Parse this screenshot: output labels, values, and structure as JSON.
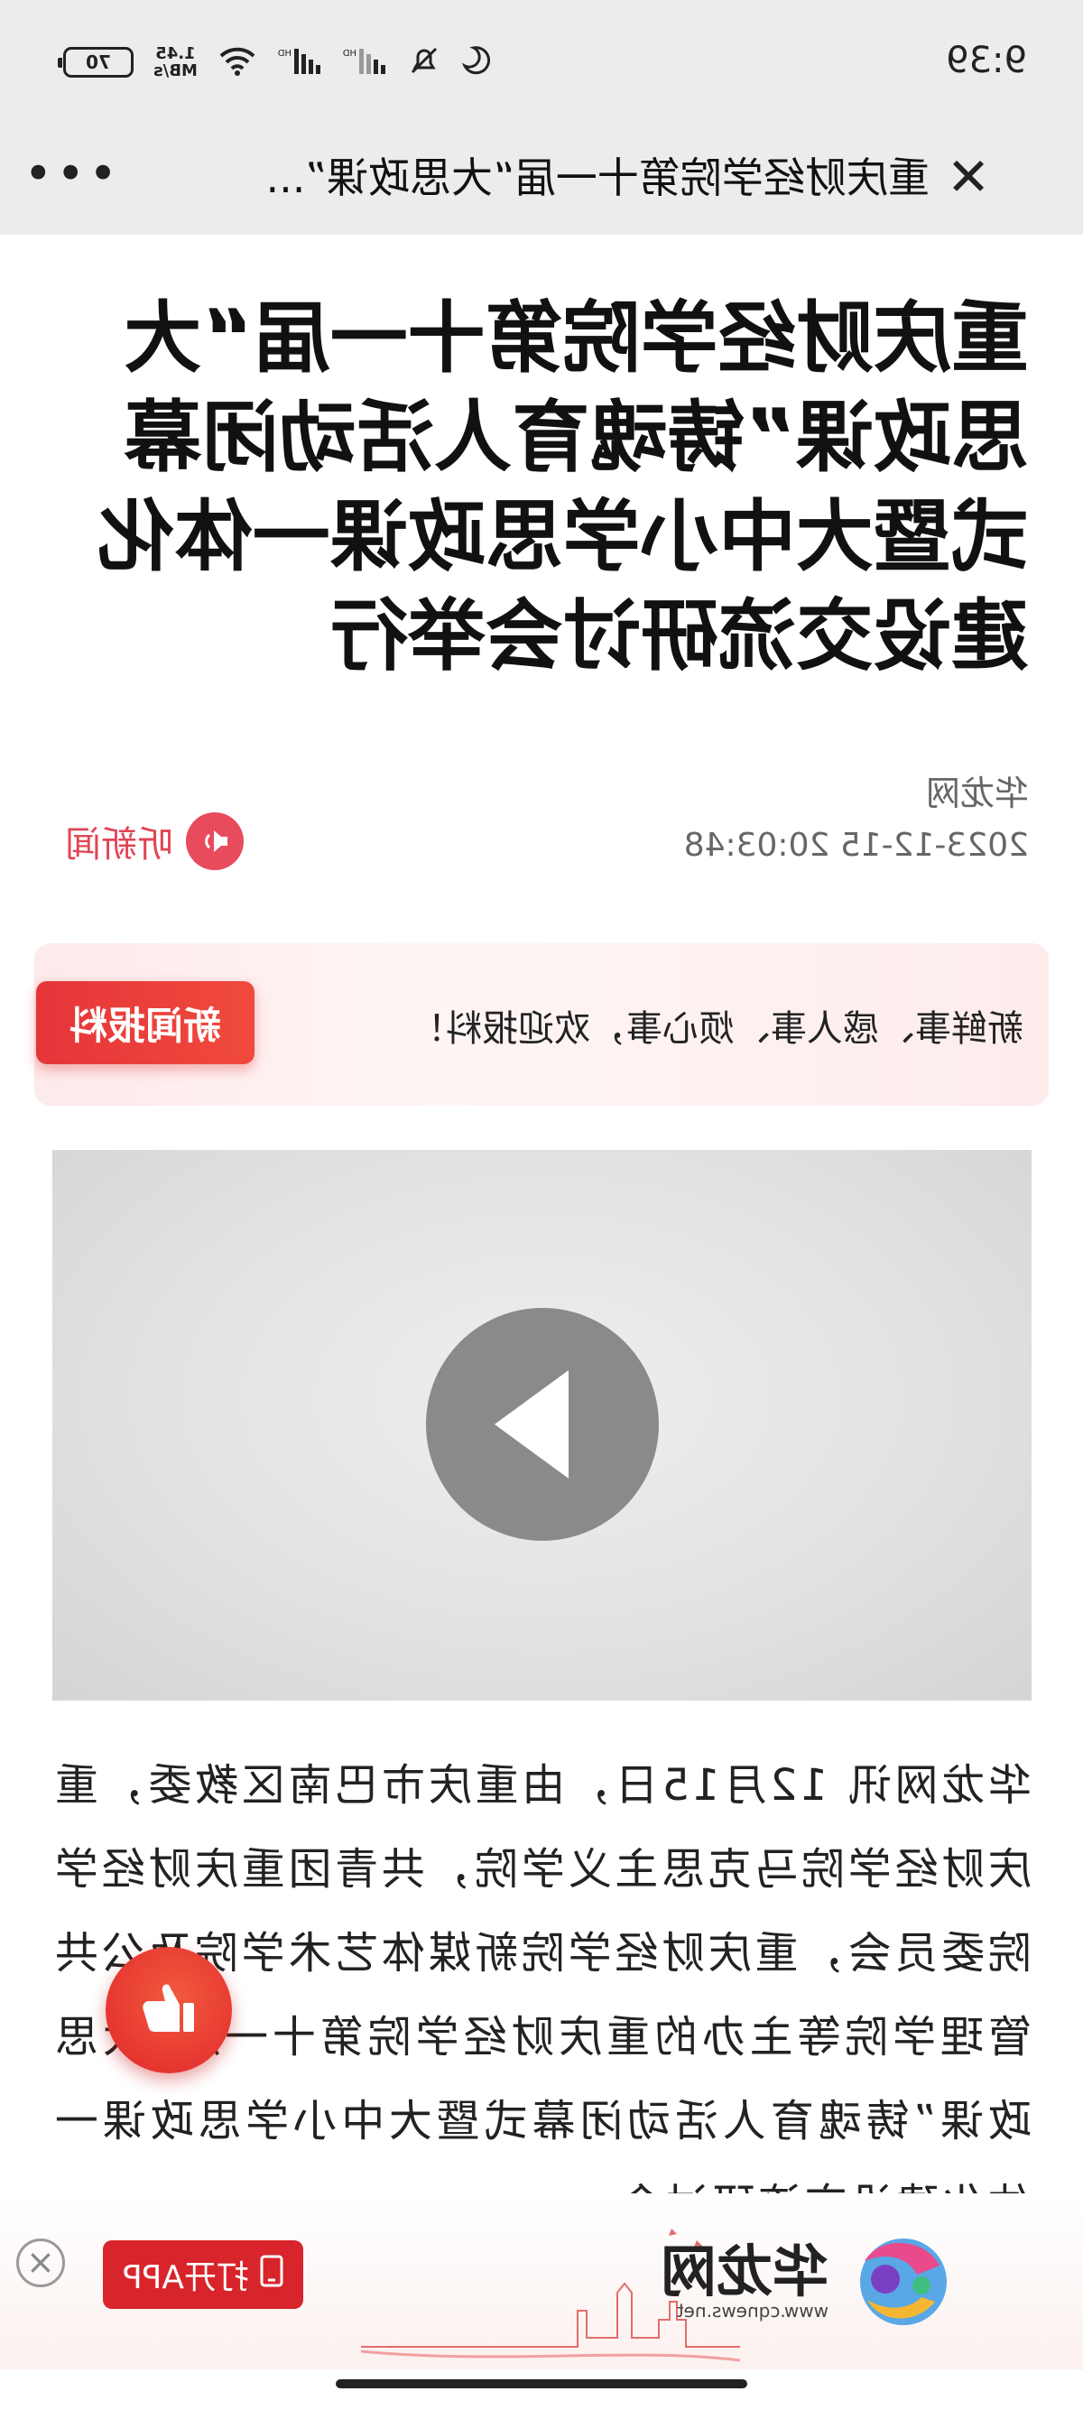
{
  "status_bar": {
    "time": "9:39",
    "network_speed_value": "1.45",
    "network_speed_unit": "MB/s",
    "battery_level": "70",
    "icons": [
      "moon-icon",
      "bell-muted-icon",
      "signal-hd-icon",
      "signal-hd-icon",
      "wifi-icon",
      "battery-icon"
    ]
  },
  "nav": {
    "title": "重庆财经学院第十一届“大思政课”...",
    "close_icon": "close-icon",
    "more_icon": "more-icon"
  },
  "article": {
    "headline": "重庆财经学院第十一届“大思政课”铸魂育人活动闭幕式暨大中小学思政课一体化建设交流研讨会举行",
    "source": "华龙网",
    "datetime": "2023-12-15 20:03:48",
    "listen_label": "听新闻",
    "body": "华龙网讯 12月15日，由重庆市巴南区教委，重庆财经学院马克思主义学院，共青团重庆财经学院委员会，重庆财经学院新媒体艺术学院及公共管理学院等主办的重庆财经学院第十一届“大思政课”铸魂育人活动闭幕式暨大中小学思政课一体化建设交流研讨会"
  },
  "tip_banner": {
    "text": "新鲜事、感人事、烦心事，欢迎报料！",
    "button_label": "新闻报料"
  },
  "video": {
    "play_icon": "play-icon"
  },
  "app_banner": {
    "brand_name": "华龙网",
    "brand_url": "www.cqnews.net",
    "open_app_label": "打开APP"
  },
  "colors": {
    "accent_red": "#e5353a",
    "listen_red": "#e04556",
    "status_bg": "#ececec"
  }
}
